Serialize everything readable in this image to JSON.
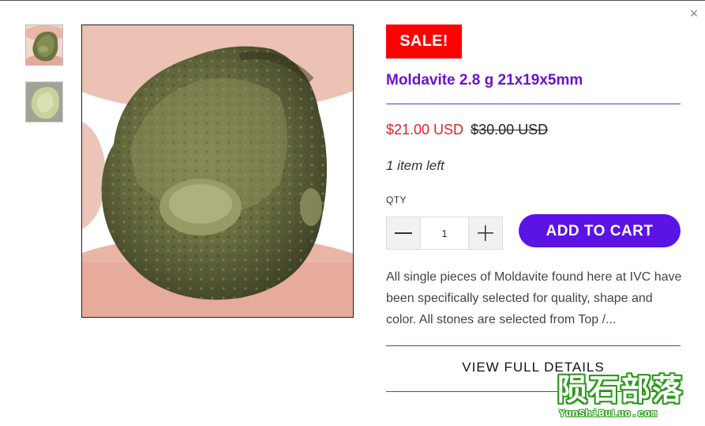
{
  "close_glyph": "×",
  "gallery": {
    "thumbnails": [
      {
        "label": "moldavite-front-thumbnail"
      },
      {
        "label": "moldavite-backlit-thumbnail"
      }
    ]
  },
  "product": {
    "badge": "SALE!",
    "title": "Moldavite 2.8 g 21x19x5mm",
    "price": "$21.00 USD",
    "compare_price": "$30.00 USD",
    "stock": "1 item left",
    "qty_label": "QTY",
    "qty_value": "1",
    "add_to_cart": "ADD TO CART",
    "description": "All single pieces of Moldavite found here at IVC have been specifically selected for quality, shape and color. All stones are selected from Top /...",
    "view_details": "VIEW FULL DETAILS"
  },
  "watermark": {
    "chinese": "陨石部落",
    "latin": "YunShiBuLuo.com"
  },
  "colors": {
    "sale_red": "#ff0000",
    "title_purple": "#6b12d3",
    "cart_button": "#5b13e6",
    "rule_purple": "#7a2bb8",
    "price_red": "#e32222",
    "watermark_green": "#2a9a1a"
  }
}
